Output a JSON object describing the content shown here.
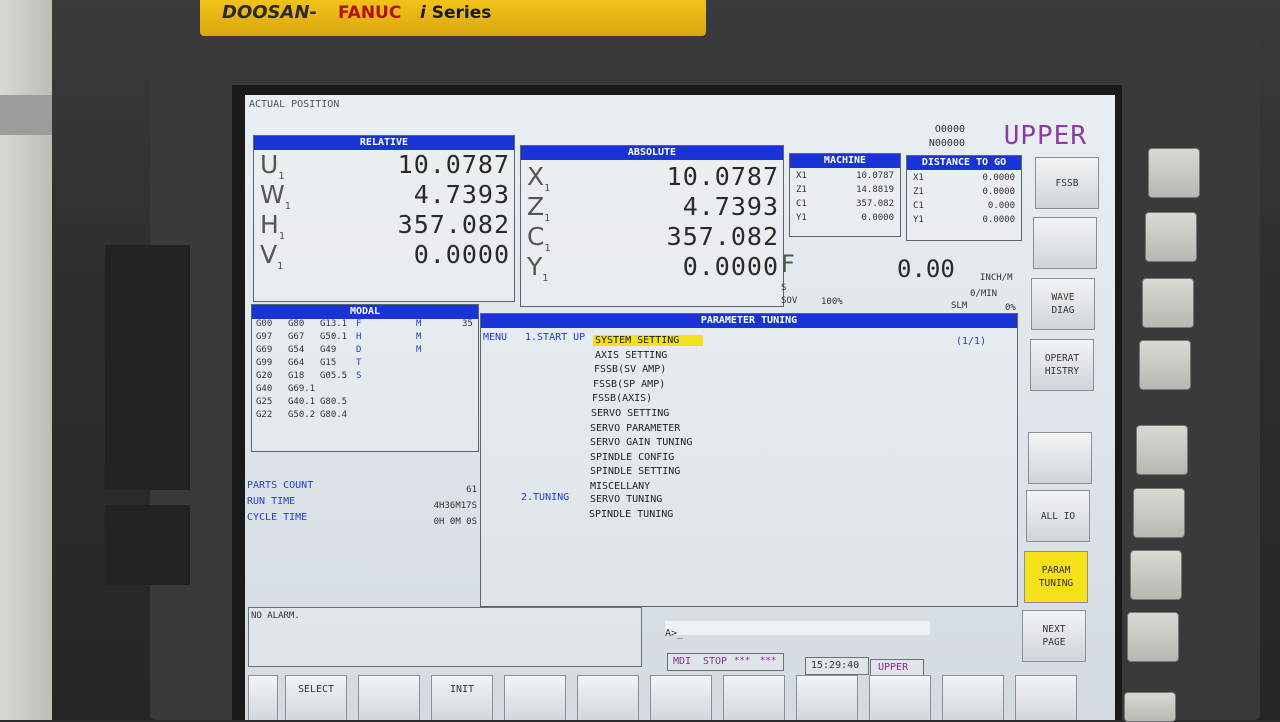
{
  "brand": {
    "doosan": "DOOSAN",
    "fanuc": "FANUC",
    "i": "i",
    "series": "Series"
  },
  "screen_title": "ACTUAL POSITION",
  "o_number": "O0000",
  "n_number": "N00000",
  "mode_big": "UPPER",
  "relative": {
    "title": "RELATIVE",
    "axes": [
      {
        "name": "U",
        "sub": "1",
        "value": "10.0787"
      },
      {
        "name": "W",
        "sub": "1",
        "value": "4.7393"
      },
      {
        "name": "H",
        "sub": "1",
        "value": "357.082"
      },
      {
        "name": "V",
        "sub": "1",
        "value": "0.0000"
      }
    ]
  },
  "absolute": {
    "title": "ABSOLUTE",
    "axes": [
      {
        "name": "X",
        "sub": "1",
        "value": "10.0787"
      },
      {
        "name": "Z",
        "sub": "1",
        "value": "4.7393"
      },
      {
        "name": "C",
        "sub": "1",
        "value": "357.082"
      },
      {
        "name": "Y",
        "sub": "1",
        "value": "0.0000"
      }
    ]
  },
  "machine": {
    "title": "MACHINE",
    "axes": [
      {
        "name": "X1",
        "value": "10.0787"
      },
      {
        "name": "Z1",
        "value": "14.8819"
      },
      {
        "name": "C1",
        "value": "357.082"
      },
      {
        "name": "Y1",
        "value": "0.0000"
      }
    ]
  },
  "distance_to_go": {
    "title": "DISTANCE TO GO",
    "axes": [
      {
        "name": "X1",
        "value": "0.0000"
      },
      {
        "name": "Z1",
        "value": "0.0000"
      },
      {
        "name": "C1",
        "value": "0.000"
      },
      {
        "name": "Y1",
        "value": "0.0000"
      }
    ]
  },
  "feed": {
    "f_label": "F",
    "f_value": "0.00",
    "f_unit": "INCH/M",
    "s_label": "S",
    "s_unit": "0/MIN",
    "sov_label": "SOV",
    "sov_value": "100%",
    "slm_label": "SLM",
    "slm_value": "0%"
  },
  "modal": {
    "title": "MODAL",
    "rows": [
      [
        "G00",
        "G80",
        "G13.1",
        "F",
        "M",
        "35"
      ],
      [
        "G97",
        "G67",
        "G50.1",
        "H",
        "M",
        ""
      ],
      [
        "G69",
        "G54",
        "G49",
        "D",
        "M",
        ""
      ],
      [
        "G99",
        "G64",
        "G15",
        "T",
        "",
        ""
      ],
      [
        "G20",
        "G18",
        "G05.5",
        "S",
        "",
        ""
      ],
      [
        "G40",
        "G69.1",
        "",
        "",
        "",
        ""
      ],
      [
        "G25",
        "G40.1",
        "G80.5",
        "",
        "",
        ""
      ],
      [
        "G22",
        "G50.2",
        "G80.4",
        "",
        "",
        ""
      ]
    ]
  },
  "counts": [
    {
      "label": "PARTS COUNT",
      "value": "61"
    },
    {
      "label": "RUN TIME",
      "value": "4H36M17S"
    },
    {
      "label": "CYCLE TIME",
      "value": "0H 0M 0S"
    }
  ],
  "param_tuning": {
    "title": "PARAMETER TUNING",
    "menu_label": "MENU",
    "page": "(1/1)",
    "section1": "1.START UP",
    "section2": "2.TUNING",
    "items1": [
      "SYSTEM SETTING",
      "AXIS SETTING",
      "FSSB(SV AMP)",
      "FSSB(SP AMP)",
      "FSSB(AXIS)",
      "SERVO SETTING",
      "SERVO PARAMETER",
      "SERVO GAIN TUNING",
      "SPINDLE CONFIG",
      "SPINDLE SETTING",
      "MISCELLANY"
    ],
    "items2": [
      "SERVO TUNING",
      "SPINDLE TUNING"
    ]
  },
  "alarm": "NO ALARM.",
  "input_prompt": "A>_",
  "status": {
    "mode": "MDI",
    "state": "STOP",
    "stars1": "***",
    "stars2": "***",
    "time": "15:29:40",
    "path": "UPPER"
  },
  "softkeys_right": [
    {
      "label": "FSSB",
      "active": false
    },
    {
      "label": "",
      "active": false
    },
    {
      "label": "WAVE\nDIAG",
      "active": false
    },
    {
      "label": "OPERAT\nHISTRY",
      "active": false
    },
    {
      "label": "",
      "active": false
    },
    {
      "label": "ALL IO",
      "active": false
    },
    {
      "label": "PARAM\nTUNING",
      "active": true
    },
    {
      "label": "NEXT\nPAGE",
      "active": false
    }
  ],
  "softkeys_bottom": [
    "",
    "SELECT",
    "",
    "INIT",
    "",
    "",
    "",
    "",
    "",
    "",
    "",
    ""
  ]
}
